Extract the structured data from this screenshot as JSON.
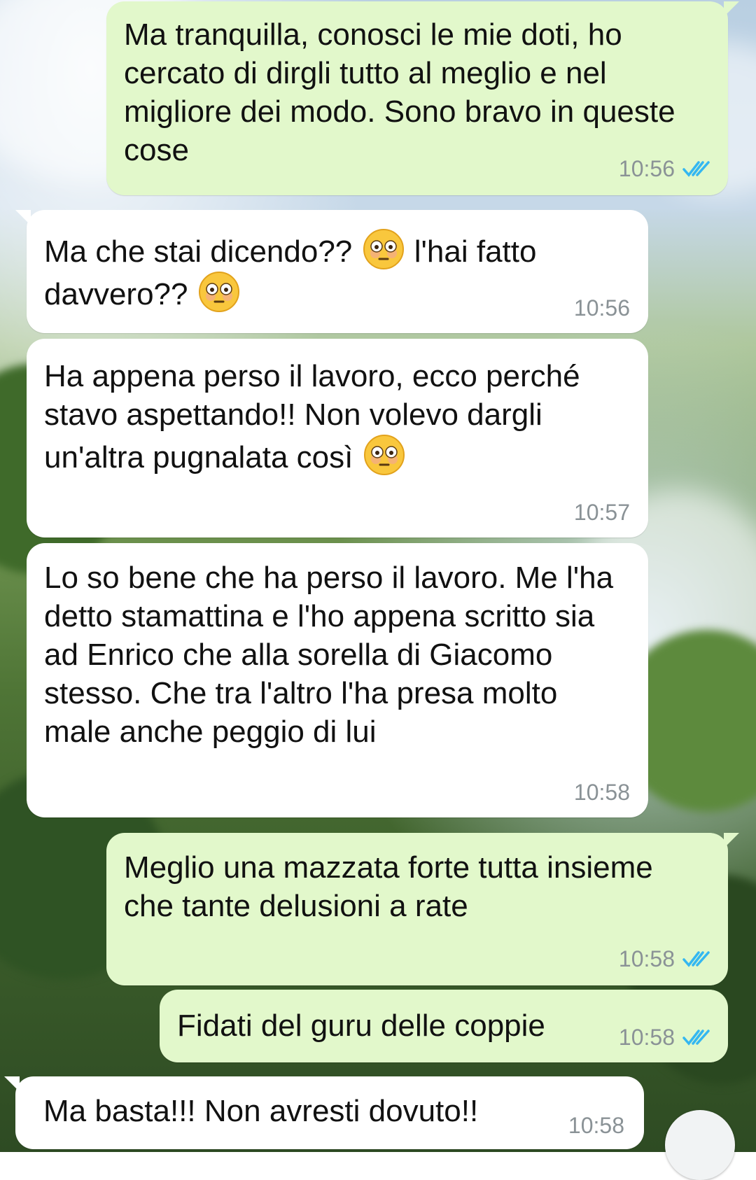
{
  "colors": {
    "outgoing_bubble": "#e2f8cb",
    "incoming_bubble": "#ffffff",
    "timestamp": "#8a9296",
    "read_ticks": "#34b7f1"
  },
  "messages": [
    {
      "direction": "outgoing",
      "text": "Ma tranquilla, conosci le mie doti, ho cercato di dirgli tutto al meglio e nel migliore dei modo. Sono bravo in queste cose",
      "time": "10:56",
      "status": "read"
    },
    {
      "direction": "incoming",
      "parts": [
        "Ma che stai dicendo?? ",
        " l'hai fatto davvero?? "
      ],
      "emoji": "flushed-face",
      "time": "10:56"
    },
    {
      "direction": "incoming",
      "parts": [
        "Ha appena perso il lavoro, ecco perché stavo aspettando!! Non volevo dargli un'altra pugnalata così "
      ],
      "emoji": "flushed-face",
      "time": "10:57"
    },
    {
      "direction": "incoming",
      "text": "Lo so bene che ha perso il lavoro. Me l'ha detto stamattina e l'ho appena scritto sia ad Enrico che alla sorella di Giacomo stesso. Che tra l'altro l'ha presa molto male anche peggio di lui",
      "time": "10:58"
    },
    {
      "direction": "outgoing",
      "text": "Meglio una mazzata forte tutta insieme che tante delusioni a rate",
      "time": "10:58",
      "status": "read"
    },
    {
      "direction": "outgoing",
      "text": "Fidati del guru delle coppie",
      "time": "10:58",
      "status": "read"
    },
    {
      "direction": "incoming",
      "text": "Ma basta!!! Non avresti dovuto!!",
      "time": "10:58"
    }
  ]
}
